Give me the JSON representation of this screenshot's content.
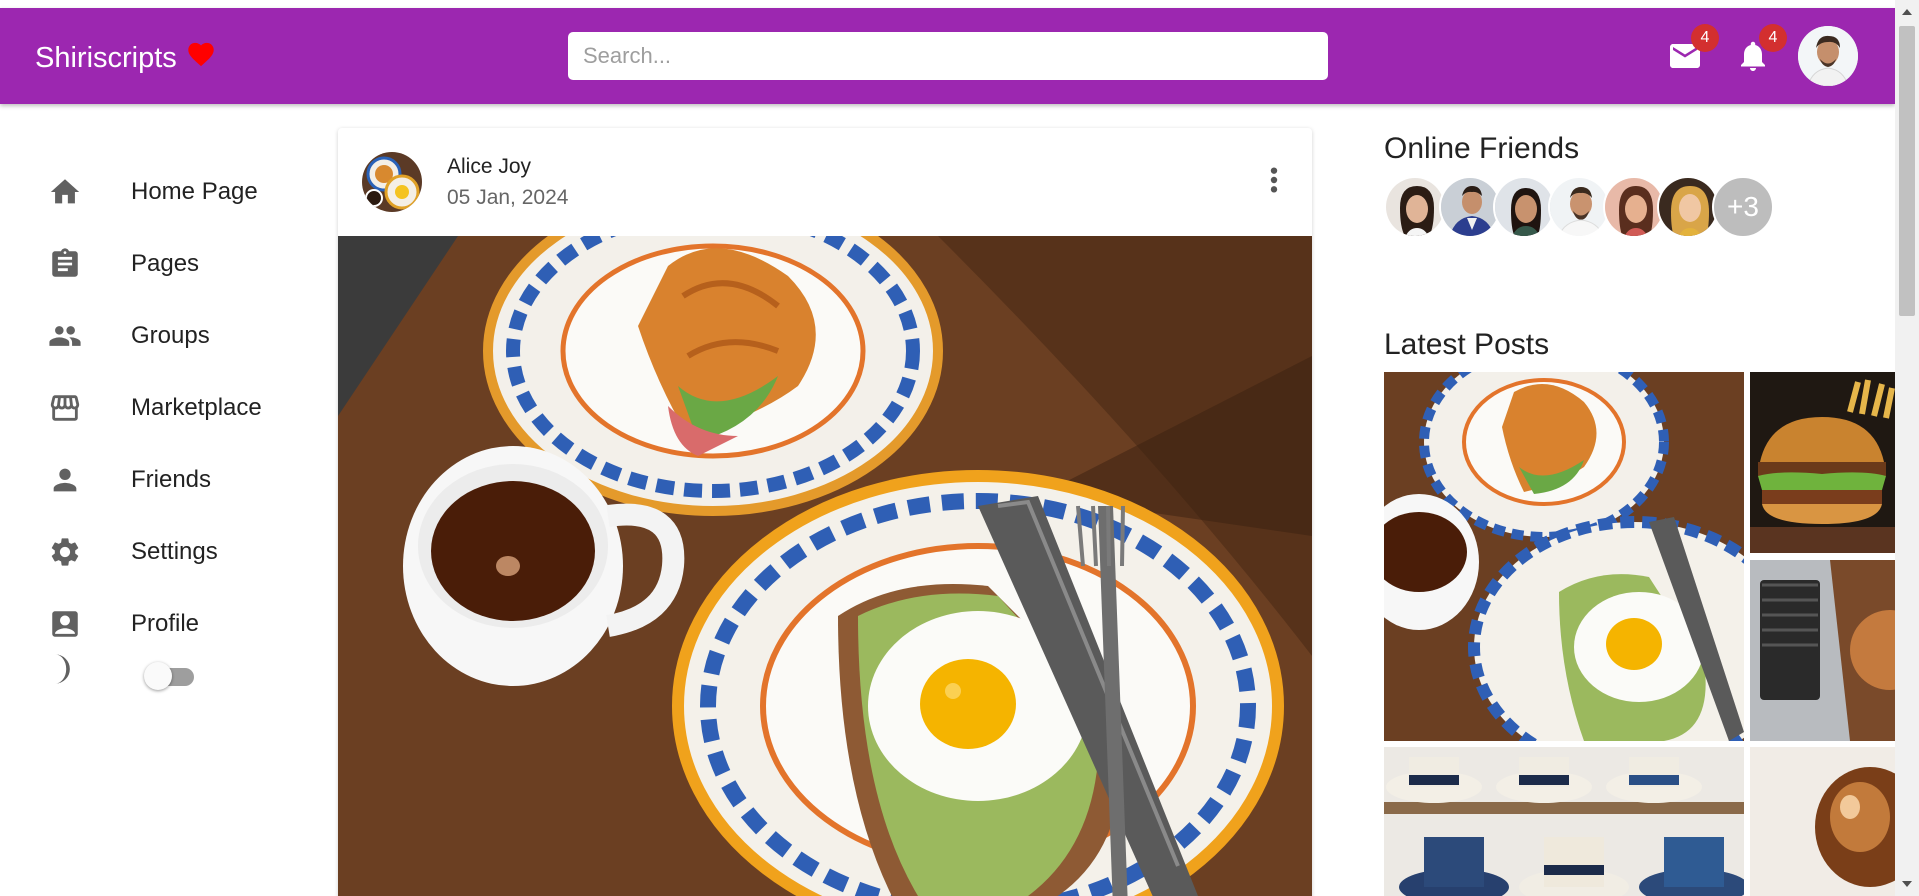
{
  "appbar": {
    "logo_text": "Shiriscripts",
    "logo_icon": "heart-icon",
    "search_placeholder": "Search...",
    "mail_badge": "4",
    "notifications_badge": "4",
    "brand_color": "#9c27b0",
    "badge_color": "#d32f2f"
  },
  "sidebar": {
    "items": [
      {
        "label": "Home Page",
        "icon": "home-icon"
      },
      {
        "label": "Pages",
        "icon": "clipboard-icon"
      },
      {
        "label": "Groups",
        "icon": "people-icon"
      },
      {
        "label": "Marketplace",
        "icon": "storefront-icon"
      },
      {
        "label": "Friends",
        "icon": "person-icon"
      },
      {
        "label": "Settings",
        "icon": "gear-icon"
      },
      {
        "label": "Profile",
        "icon": "account-box-icon"
      }
    ],
    "theme_toggle_icon": "moon-icon",
    "theme_toggle_on": false
  },
  "post": {
    "author": "Alice Joy",
    "date": "05 Jan, 2024"
  },
  "rightbar": {
    "online_title": "Online Friends",
    "more_count": "+3",
    "latest_title": "Latest Posts"
  }
}
